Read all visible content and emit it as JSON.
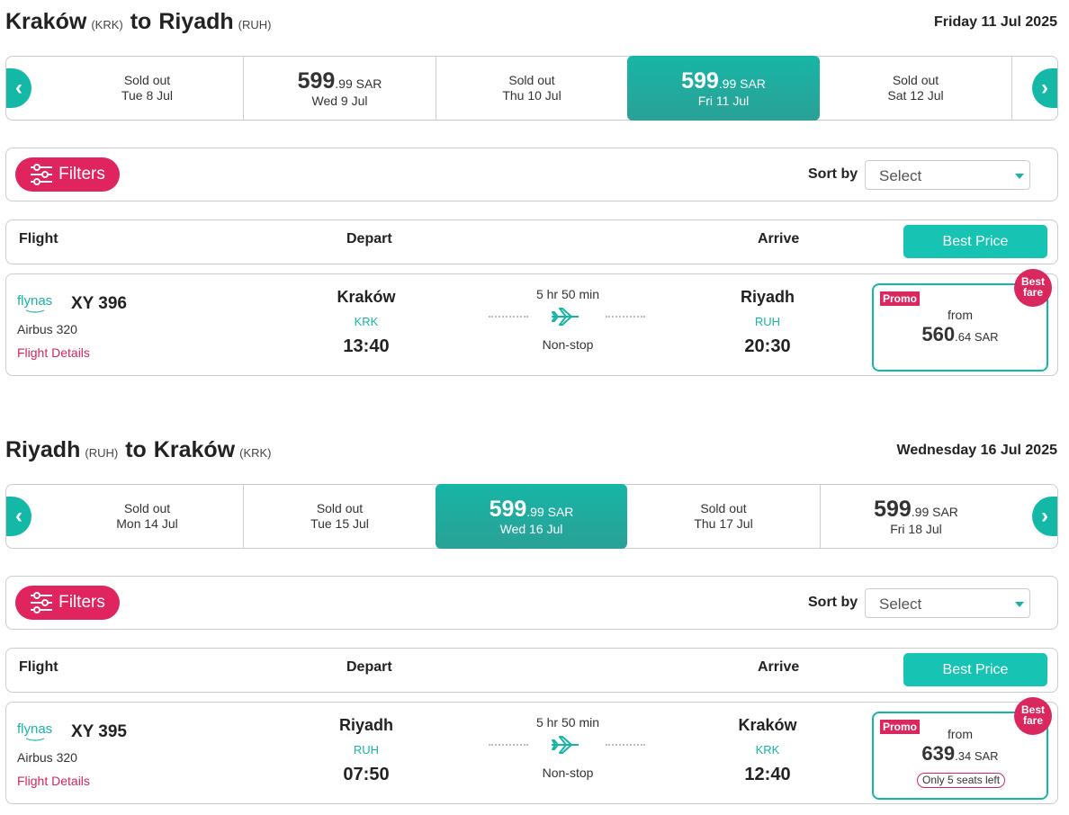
{
  "outbound": {
    "origin_city": "Kraków",
    "origin_code": "(KRK)",
    "to_word": "to",
    "dest_city": "Riyadh",
    "dest_code": "(RUH)",
    "selected_date": "Friday 11 Jul 2025",
    "dates": [
      {
        "label": "Tue 8 Jul",
        "status": "Sold out"
      },
      {
        "label": "Wed 9 Jul",
        "price_main": "599",
        "price_dec": ".99 SAR"
      },
      {
        "label": "Thu 10 Jul",
        "status": "Sold out"
      },
      {
        "label": "Fri 11 Jul",
        "price_main": "599",
        "price_dec": ".99 SAR",
        "selected": true
      },
      {
        "label": "Sat 12 Jul",
        "status": "Sold out"
      }
    ],
    "filters_label": "Filters",
    "sort_label": "Sort by",
    "sort_value": "Select",
    "col_flight": "Flight",
    "col_depart": "Depart",
    "col_arrive": "Arrive",
    "best_price_label": "Best Price",
    "flight": {
      "airline": "flynas",
      "number": "XY 396",
      "aircraft": "Airbus 320",
      "details_link": "Flight Details",
      "dep_city": "Kraków",
      "dep_code": "KRK",
      "dep_time": "13:40",
      "duration": "5 hr 50 min",
      "stops": "Non-stop",
      "arr_city": "Riyadh",
      "arr_code": "RUH",
      "arr_time": "20:30",
      "promo": "Promo",
      "from": "from",
      "price_main": "560",
      "price_dec": ".64 SAR",
      "badge_line1": "Best",
      "badge_line2": "fare"
    }
  },
  "inbound": {
    "origin_city": "Riyadh",
    "origin_code": "(RUH)",
    "to_word": "to",
    "dest_city": "Kraków",
    "dest_code": "(KRK)",
    "selected_date": "Wednesday 16 Jul 2025",
    "dates": [
      {
        "label": "Mon 14 Jul",
        "status": "Sold out"
      },
      {
        "label": "Tue 15 Jul",
        "status": "Sold out"
      },
      {
        "label": "Wed 16 Jul",
        "price_main": "599",
        "price_dec": ".99 SAR",
        "selected": true
      },
      {
        "label": "Thu 17 Jul",
        "status": "Sold out"
      },
      {
        "label": "Fri 18 Jul",
        "price_main": "599",
        "price_dec": ".99 SAR"
      }
    ],
    "filters_label": "Filters",
    "sort_label": "Sort by",
    "sort_value": "Select",
    "col_flight": "Flight",
    "col_depart": "Depart",
    "col_arrive": "Arrive",
    "best_price_label": "Best Price",
    "flight": {
      "airline": "flynas",
      "number": "XY 395",
      "aircraft": "Airbus 320",
      "details_link": "Flight Details",
      "dep_city": "Riyadh",
      "dep_code": "RUH",
      "dep_time": "07:50",
      "duration": "5 hr 50 min",
      "stops": "Non-stop",
      "arr_city": "Kraków",
      "arr_code": "KRK",
      "arr_time": "12:40",
      "promo": "Promo",
      "from": "from",
      "price_main": "639",
      "price_dec": ".34 SAR",
      "seats_left": "Only 5 seats left",
      "badge_line1": "Best",
      "badge_line2": "fare"
    }
  },
  "colors": {
    "accent_teal": "#17b5a6",
    "accent_pink": "#e0245e"
  },
  "icons": {
    "nav_prev": "chevron-left-icon",
    "nav_next": "chevron-right-icon",
    "filters": "sliders-icon",
    "plane": "airplane-icon",
    "dropdown": "caret-down-icon"
  }
}
